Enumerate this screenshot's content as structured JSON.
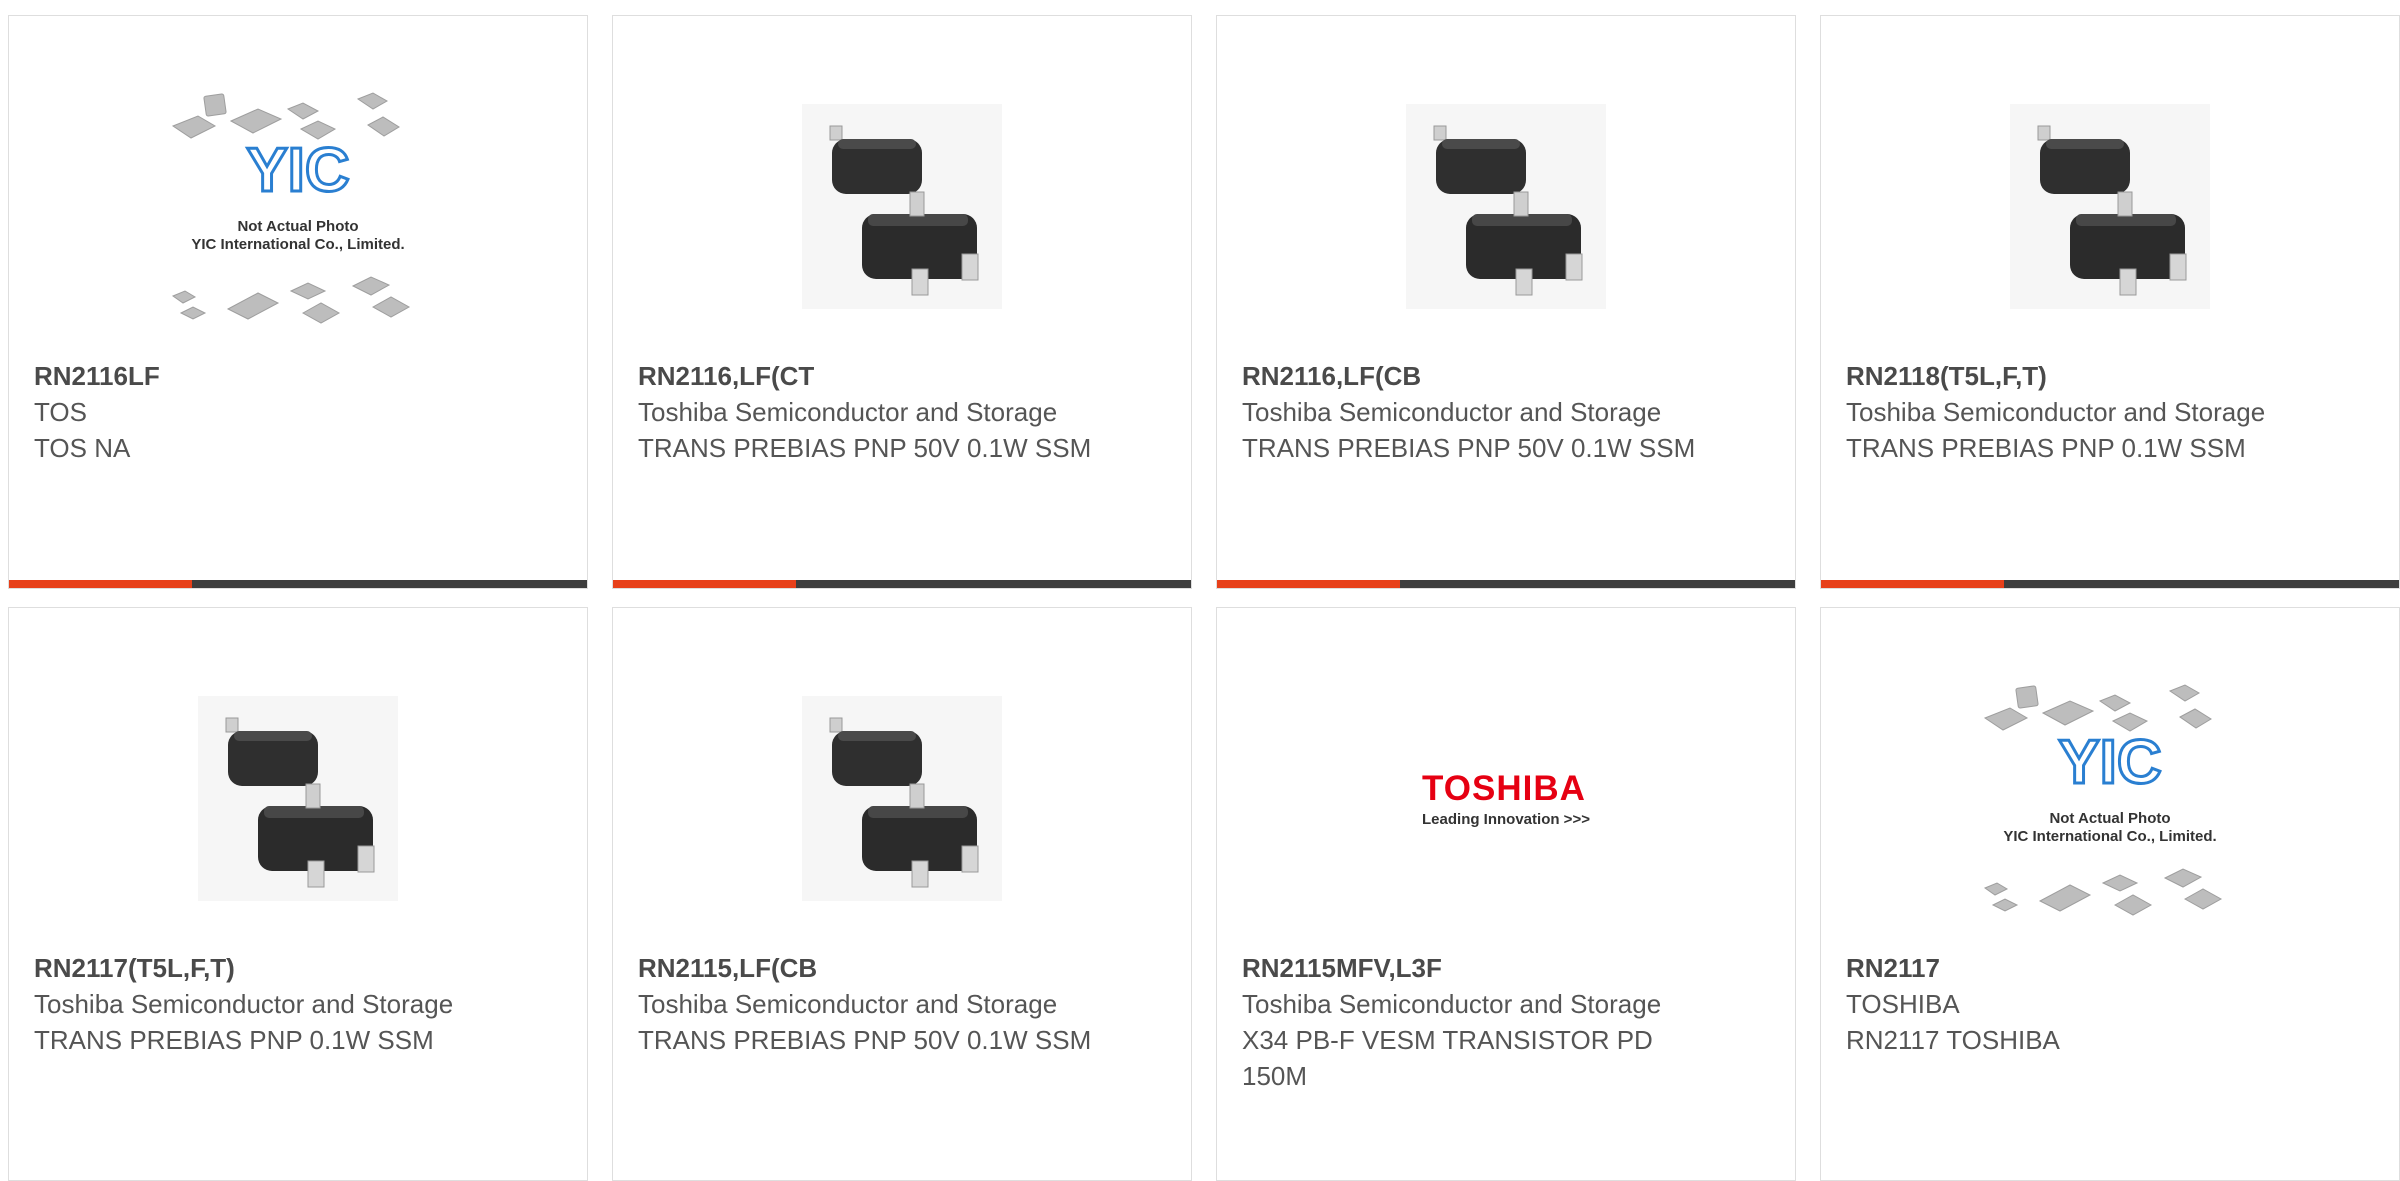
{
  "colors": {
    "accent": "#e7401a",
    "bar": "#3d3d3d",
    "border": "#dedede",
    "text": "#555555"
  },
  "placeholder": {
    "line1": "Not Actual Photo",
    "line2": "YIC International Co., Limited.",
    "logo": "YIC"
  },
  "toshiba_logo": {
    "word": "TOSHIBA",
    "tagline": "Leading Innovation >>>"
  },
  "products": [
    {
      "part": "RN2116LF",
      "mfr": "TOS",
      "desc": "TOS NA",
      "image": "placeholder-image",
      "bar": true
    },
    {
      "part": "RN2116,LF(CT",
      "mfr": "Toshiba Semiconductor and Storage",
      "desc": "TRANS PREBIAS PNP 50V 0.1W SSM",
      "image": "sot-package-image",
      "bar": true
    },
    {
      "part": "RN2116,LF(CB",
      "mfr": "Toshiba Semiconductor and Storage",
      "desc": "TRANS PREBIAS PNP 50V 0.1W SSM",
      "image": "sot-package-image",
      "bar": true
    },
    {
      "part": "RN2118(T5L,F,T)",
      "mfr": "Toshiba Semiconductor and Storage",
      "desc": "TRANS PREBIAS PNP 0.1W SSM",
      "image": "sot-package-image",
      "bar": true
    },
    {
      "part": "RN2117(T5L,F,T)",
      "mfr": "Toshiba Semiconductor and Storage",
      "desc": "TRANS PREBIAS PNP 0.1W SSM",
      "image": "sot-package-image",
      "bar": false
    },
    {
      "part": "RN2115,LF(CB",
      "mfr": "Toshiba Semiconductor and Storage",
      "desc": "TRANS PREBIAS PNP 50V 0.1W SSM",
      "image": "sot-package-image",
      "bar": false
    },
    {
      "part": "RN2115MFV,L3F",
      "mfr": "Toshiba Semiconductor and Storage",
      "desc": "X34 PB-F VESM TRANSISTOR PD 150M",
      "image": "toshiba-logo-image",
      "bar": false
    },
    {
      "part": "RN2117",
      "mfr": "TOSHIBA",
      "desc": "RN2117 TOSHIBA",
      "image": "placeholder-image",
      "bar": false
    }
  ]
}
